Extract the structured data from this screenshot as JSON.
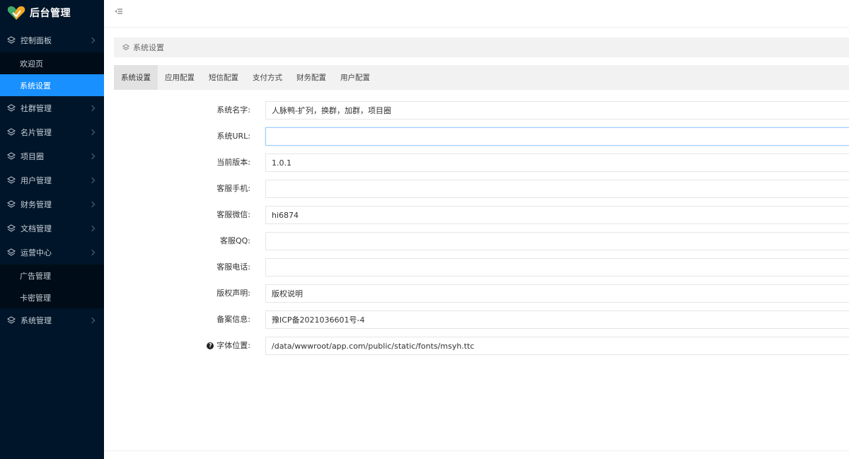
{
  "app": {
    "title": "后台管理"
  },
  "colors": {
    "sidebar_bg": "#001529",
    "submenu_bg": "#000c17",
    "accent": "#1890ff",
    "logo_green": "#3fa96a",
    "logo_orange": "#f5a623"
  },
  "sidebar": {
    "groups": [
      {
        "label": "控制面板",
        "icon": "layers-icon",
        "children": [
          "欢迎页",
          "系统设置"
        ]
      },
      {
        "label": "社群管理",
        "icon": "layers-icon"
      },
      {
        "label": "名片管理",
        "icon": "layers-icon"
      },
      {
        "label": "项目圈",
        "icon": "layers-icon"
      },
      {
        "label": "用户管理",
        "icon": "layers-icon"
      },
      {
        "label": "财务管理",
        "icon": "layers-icon"
      },
      {
        "label": "文档管理",
        "icon": "layers-icon"
      },
      {
        "label": "运营中心",
        "icon": "layers-icon",
        "children": [
          "广告管理",
          "卡密管理"
        ]
      },
      {
        "label": "系统管理",
        "icon": "layers-icon"
      }
    ],
    "active_item": "系统设置"
  },
  "topbar": {
    "fold_icon": "menu-fold-icon"
  },
  "breadcrumb": {
    "label": "系统设置",
    "icon": "layers-icon"
  },
  "tabs": [
    "系统设置",
    "应用配置",
    "短信配置",
    "支付方式",
    "财务配置",
    "用户配置"
  ],
  "form": {
    "fields": [
      {
        "label": "系统名字:",
        "value": "人脉鸭-扩列，换群，加群，项目圈"
      },
      {
        "label": "系统URL:",
        "value": ""
      },
      {
        "label": "当前版本:",
        "value": "1.0.1"
      },
      {
        "label": "客服手机:",
        "value": ""
      },
      {
        "label": "客服微信:",
        "value": "hi6874"
      },
      {
        "label": "客服QQ:",
        "value": ""
      },
      {
        "label": "客服电话:",
        "value": ""
      },
      {
        "label": "版权声明:",
        "value": "版权说明"
      },
      {
        "label": "备案信息:",
        "value": "豫ICP备2021036601号-4"
      },
      {
        "label": "字体位置:",
        "value": "/data/wwwroot/app.com/public/static/fonts/msyh.ttc",
        "help_icon": "question-circle-icon"
      }
    ]
  }
}
